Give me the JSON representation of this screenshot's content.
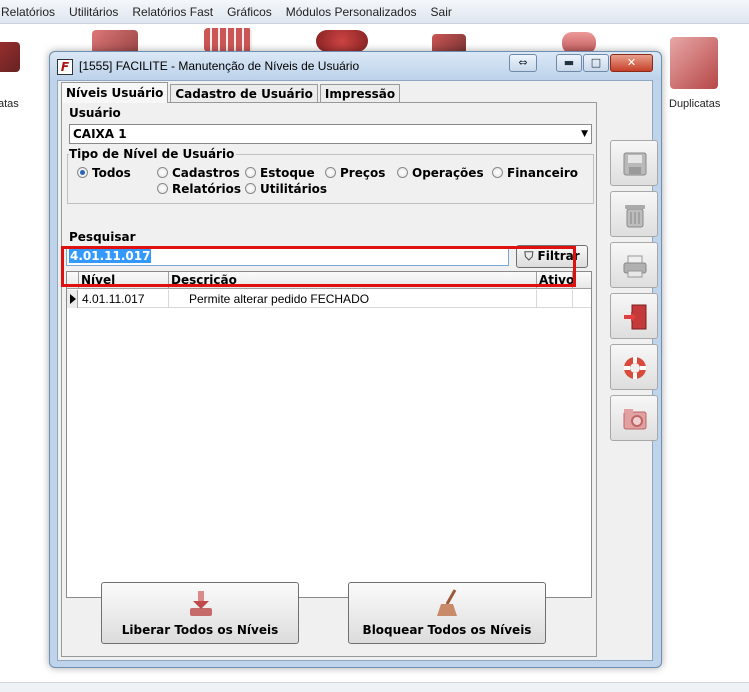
{
  "menu": [
    "Relatórios",
    "Utilitários",
    "Relatórios Fast",
    "Gráficos",
    "Módulos Personalizados",
    "Sair"
  ],
  "background": {
    "left_label": "atas",
    "right_icon_label": "Duplicatas"
  },
  "window": {
    "title": "[1555] FACILITE - Manutenção de Níveis de Usuário",
    "app_glyph": "F",
    "tabs": [
      "Níveis Usuário",
      "Cadastro de Usuário",
      "Impressão"
    ]
  },
  "form": {
    "user_label": "Usuário",
    "user_value": "CAIXA 1",
    "level_type_label": "Tipo de Nível de Usuário",
    "options": [
      "Todos",
      "Cadastros",
      "Estoque",
      "Preços",
      "Operações",
      "Financeiro",
      "Relatórios",
      "Utilitários"
    ],
    "selected_option": "Todos",
    "search_label": "Pesquisar",
    "search_value": "4.01.11.017",
    "filter_button": "Filtrar"
  },
  "grid": {
    "columns": [
      "Nível",
      "Descrição",
      "Ativo"
    ],
    "rows": [
      {
        "level": "4.01.11.017",
        "description": "Permite alterar pedido FECHADO",
        "active": ""
      }
    ]
  },
  "buttons": {
    "release_all": "Liberar Todos os Níveis",
    "block_all": "Bloquear Todos os Níveis"
  },
  "side_tools": [
    "save-icon",
    "trash-icon",
    "printer-icon",
    "exit-door-icon",
    "lifebuoy-icon",
    "settings-folder-icon"
  ],
  "colors": {
    "highlight": "#e01010",
    "selection": "#3399ff",
    "window_frame": "#bfd4ea"
  }
}
